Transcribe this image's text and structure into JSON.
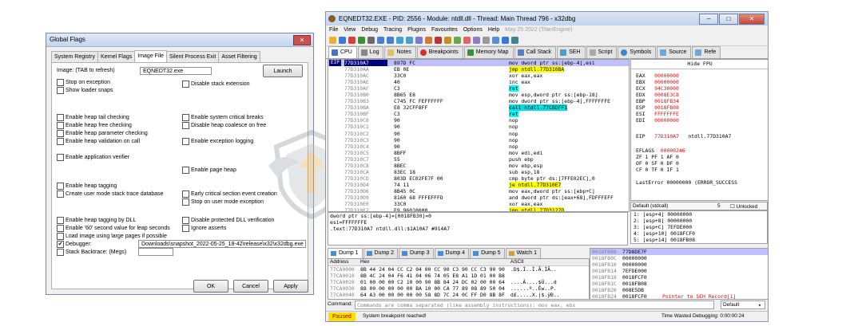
{
  "global_flags": {
    "title": "Global Flags",
    "close": "✕",
    "tabs": [
      "System Registry",
      "Kernel Flags",
      "Image File",
      "Silent Process Exit",
      "Asset Filtering"
    ],
    "image_label": "Image: (TAB to refresh)",
    "image_value": "EQNEDT32.exe",
    "launch": "Launch",
    "stop_on_exception": "Stop on exception",
    "show_loader_snaps": "Show loader snaps",
    "disable_stack_extension": "Disable stack extension",
    "left_group1": [
      "Enable heap tail checking",
      "Enable heap free checking",
      "Enable heap parameter checking",
      "Enable heap validation on call"
    ],
    "right_group1": [
      "Enable system critical breaks",
      "Disable heap coalesce on free"
    ],
    "enable_exception_logging": "Enable exception logging",
    "enable_application_verifier": "Enable application verifier",
    "enable_page_heap": "Enable page heap",
    "enable_heap_tagging": "Enable heap tagging",
    "create_user_mode_stack": "Create user mode stack trace database",
    "early_critical_section": "Early critical section event creation",
    "stop_on_user_mode_exception": "Stop on user mode exception",
    "enable_heap_tagging_dll": "Enable heap tagging by DLL",
    "enable_60_second": "Enable '60' second value for leap seconds",
    "load_image_large_pages": "Load image using large pages if possible",
    "disable_protected_dll": "Disable protected DLL verification",
    "ignore_asserts": "Ignore asserts",
    "debugger_label": "Debugger:",
    "debugger_check": "✔",
    "debugger_value": "Downloads\\snapshot_2022-05-25_18-42\\release\\x32\\x32dbg.exe",
    "stack_backtrace": "Stack Backtrace: (Megs)",
    "ok": "OK",
    "cancel": "Cancel",
    "apply": "Apply"
  },
  "debugger": {
    "title": "EQNEDT32.EXE - PID: 2556 - Module: ntdll.dll - Thread: Main Thread 796 - x32dbg",
    "menu": [
      "File",
      "View",
      "Debug",
      "Tracing",
      "Plugins",
      "Favourites",
      "Options",
      "Help"
    ],
    "version_date": "May 25 2022 (TitanEngine)",
    "tabs": [
      "CPU",
      "Log",
      "Notes",
      "Breakpoints",
      "Memory Map",
      "Call Stack",
      "SEH",
      "Script",
      "Symbols",
      "Source",
      "Refe"
    ],
    "eip_label": "EIP",
    "disasm": [
      {
        "addr": "77D310A7",
        "bytes": "897D FC",
        "instr": "mov dword ptr ss:[ebp-4],esi"
      },
      {
        "addr": "77D310AA",
        "bytes": "EB 0E",
        "instr": "jmp ntdll.77D310BA"
      },
      {
        "addr": "77D310AC",
        "bytes": "33C0",
        "instr": "xor eax,eax"
      },
      {
        "addr": "77D310AE",
        "bytes": "40",
        "instr": "inc eax"
      },
      {
        "addr": "77D310AF",
        "bytes": "C3",
        "instr": "ret"
      },
      {
        "addr": "77D310B0",
        "bytes": "8B65 E8",
        "instr": "mov esp,dword ptr ss:[ebp-18]"
      },
      {
        "addr": "77D310B3",
        "bytes": "C745 FC FEFFFFFF",
        "instr": "mov dword ptr ss:[ebp-4],FFFFFFFE"
      },
      {
        "addr": "77D310BA",
        "bytes": "E8 32CFF8FF",
        "instr": "call ntdll.77CBDFF1"
      },
      {
        "addr": "77D310BF",
        "bytes": "C3",
        "instr": "ret"
      },
      {
        "addr": "77D310C0",
        "bytes": "90",
        "instr": "nop"
      },
      {
        "addr": "77D310C1",
        "bytes": "90",
        "instr": "nop"
      },
      {
        "addr": "77D310C2",
        "bytes": "90",
        "instr": "nop"
      },
      {
        "addr": "77D310C3",
        "bytes": "90",
        "instr": "nop"
      },
      {
        "addr": "77D310C4",
        "bytes": "90",
        "instr": "nop"
      },
      {
        "addr": "77D310C5",
        "bytes": "8BFF",
        "instr": "mov edi,edi"
      },
      {
        "addr": "77D310C7",
        "bytes": "55",
        "instr": "push ebp"
      },
      {
        "addr": "77D310C8",
        "bytes": "8BEC",
        "instr": "mov ebp,esp"
      },
      {
        "addr": "77D310CA",
        "bytes": "83EC 18",
        "instr": "sub esp,18"
      },
      {
        "addr": "77D310CD",
        "bytes": "803D EC02FE7F 00",
        "instr": "cmp byte ptr ds:[7FFE02EC],0"
      },
      {
        "addr": "77D310D4",
        "bytes": "74 11",
        "instr": "je ntdll.77D310E7"
      },
      {
        "addr": "77D310D6",
        "bytes": "8B45 0C",
        "instr": "mov eax,dword ptr ss:[ebp+C]"
      },
      {
        "addr": "77D310D9",
        "bytes": "8160 68 FFFEFFFD",
        "instr": "and dword ptr ds:[eax+68],FDFFFEFF"
      },
      {
        "addr": "77D310E0",
        "bytes": "33C0",
        "instr": "xor eax,eax"
      },
      {
        "addr": "77D310E2",
        "bytes": "E9 96010000",
        "instr": "jmp ntdll.77D3127D"
      }
    ],
    "hide_fpu": "Hide FPU",
    "registers": [
      {
        "n": "EAX",
        "v": "00000000"
      },
      {
        "n": "EBX",
        "v": "00000000"
      },
      {
        "n": "ECX",
        "v": "94C30000"
      },
      {
        "n": "EDX",
        "v": "0008E3C8"
      },
      {
        "n": "EBP",
        "v": "0018FB34"
      },
      {
        "n": "ESP",
        "v": "0018FB08"
      },
      {
        "n": "ESI",
        "v": "FFFFFFFE"
      },
      {
        "n": "EDI",
        "v": "00000000"
      }
    ],
    "eip_reg": {
      "n": "EIP",
      "v": "77D310A7",
      "s": "ntdll.77D310A7"
    },
    "eflags": {
      "n": "EFLAGS",
      "v": "00000246"
    },
    "flags": [
      "ZF 1  PF 1  AF 0",
      "OF 0  SF 0  DF 0",
      "CF 0  TF 0  IF 1"
    ],
    "lasterror": "LastError  00000000 (ERROR_SUCCESS",
    "call_conv": "Default (stdcall)",
    "arg_count": "5",
    "unlocked": "Unlocked",
    "args": [
      "1: [esp+4] 00000000",
      "2: [esp+8] 00000000",
      "3: [esp+C] 7EFDE000",
      "4: [esp+10] 0018FCF0",
      "5: [esp+14] 0018FB08"
    ],
    "info": [
      "dword ptr ss:[ebp-4]=[0018FB30]=0",
      "esi=FFFFFFFE",
      "",
      ".text:77D310A7 ntdll.dll:$1A10A7 #914A7"
    ],
    "dump_tabs": [
      "Dump 1",
      "Dump 2",
      "Dump 3",
      "Dump 4",
      "Dump 5",
      "Watch 1"
    ],
    "dump_headers": {
      "address": "Address",
      "hex": "Hex",
      "ascii": "ASCII"
    },
    "dump": [
      {
        "addr": "77CA0000",
        "hex": "8B 44 24 04 CC C2 04 00 CC 90 C3 90 CC C3 90 90",
        "ascii": ".D$.Ì..Ì.Ã.ÌÃ.."
      },
      {
        "addr": "77CA0010",
        "hex": "8B 4C 24 04 F6 41 04 06 74 05 E8 A1 1D 01 00 B8",
        ".L$.öA..t.è¡...¸": ""
      },
      {
        "addr": "77CA0020",
        "hex": "01 00 00 00 C2 10 00 90 8B 84 24 DC 02 00 00 64",
        "ascii": "....Â....$Ü...d"
      },
      {
        "addr": "77CA0030",
        "hex": "88 00 00 00 00 00 BA 10 00 CA 77 89 08 89 50 04",
        "ascii": "......º..Êw..P."
      },
      {
        "addr": "77CA0040",
        "hex": "64 A3 00 00 00 00 00 58 8D 7C 24 0C FF D0 8B 8F",
        "ascii": "d£.....X.|$.ÿÐ.."
      },
      {
        "addr": "77CA0050",
        "hex": "02 00 00 64 89 00 00 00 00 6A 01 57 E8 8E FE FF",
        "ascii": "...d.....j.Wè.þÿ"
      },
      {
        "addr": "77CA0060",
        "hex": "00 00 8B F0 56 E8 23 38 05 00 EB F8 C2 10 00 90",
        "ascii": "...ðVè#8..ëøÂ..."
      },
      {
        "addr": "77CA0070",
        "hex": "64 8B 0D 30 00 00 00 8B 49 10 F6 41 08 75 15 ...",
        "ascii": "d..0....I.öA.u.."
      }
    ],
    "stack": [
      {
        "a": "0018FB08",
        "v": "77D8DE7F",
        "c": ""
      },
      {
        "a": "0018FB0C",
        "v": "00000000",
        "c": ""
      },
      {
        "a": "0018FB10",
        "v": "00000000",
        "c": ""
      },
      {
        "a": "0018FB14",
        "v": "7EFDE000",
        "c": ""
      },
      {
        "a": "0018FB18",
        "v": "0018FCF0",
        "c": ""
      },
      {
        "a": "0018FB1C",
        "v": "0018FB08",
        "c": ""
      },
      {
        "a": "0018FB20",
        "v": "008E5DB",
        "c": ""
      },
      {
        "a": "0018FB24",
        "v": "0018FCF0",
        "c": "Pointer to SEH_Record[1]"
      },
      {
        "a": "0018FB28",
        "v": "77D04DCD",
        "c": "ntdll.77D04DCD"
      },
      {
        "a": "0018FB2C",
        "v": "00089BA3",
        "c": ""
      },
      {
        "a": "0018FB30",
        "v": "00000000",
        "c": ""
      }
    ],
    "command_label": "Command:",
    "command_placeholder": "Commands are comma separated (like assembly instructions): mov eax, ebx",
    "command_mode": "Default",
    "paused": "Paused",
    "status_msg": "System breakpoint reached!",
    "time_wasted": "Time Wasted Debugging: 0:00:00:24"
  }
}
